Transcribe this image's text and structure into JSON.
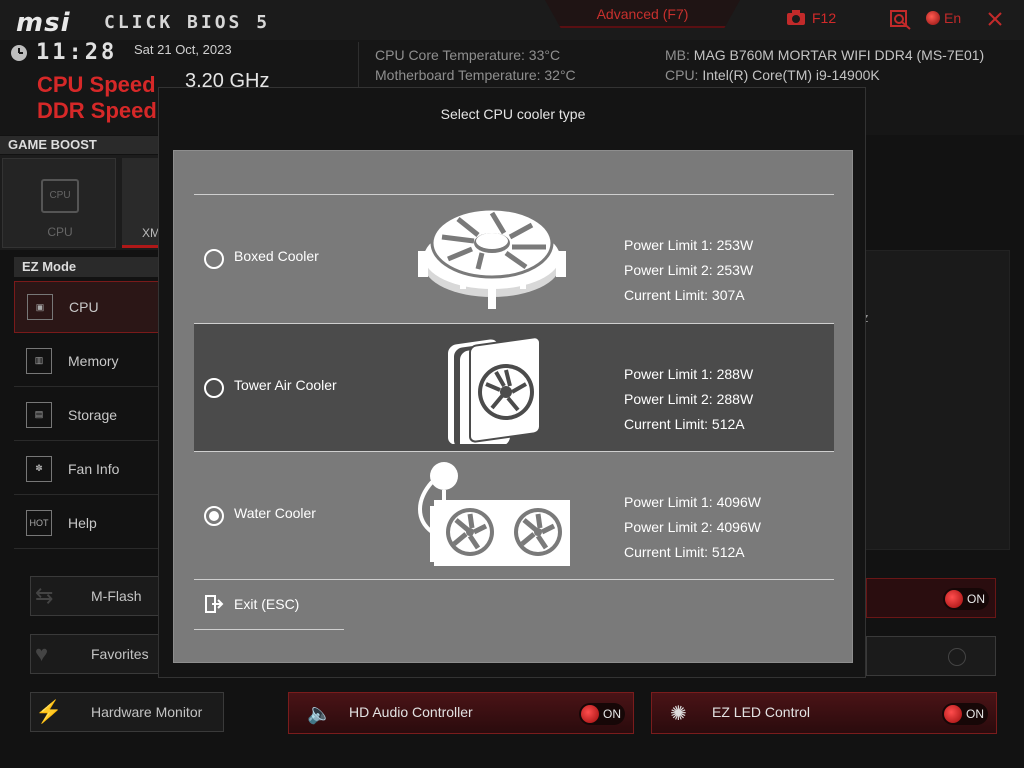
{
  "header": {
    "logo": "msi",
    "bios_name": "CLICK BIOS 5",
    "advanced_tab": "Advanced (F7)",
    "screenshot_key": "F12",
    "language": "En",
    "icons": [
      "camera-icon",
      "search-icon",
      "globe-icon",
      "close-icon"
    ]
  },
  "info": {
    "time": "11:28",
    "date": "Sat  21 Oct, 2023",
    "cpu_speed_label": "CPU Speed",
    "cpu_speed_value": "3.20 GHz",
    "ddr_speed_label": "DDR Speed",
    "cpu_temp": "CPU Core Temperature: 33°C",
    "mb_temp": "Motherboard Temperature: 32°C",
    "mb_label": "MB:",
    "mb_value": "MAG B760M MORTAR WIFI DDR4 (MS-7E01)",
    "cpu_label": "CPU:",
    "cpu_value": "Intel(R) Core(TM) i9-14900K"
  },
  "game_boost": {
    "title": "GAME BOOST",
    "cpu_tab": "CPU",
    "xmp_tab": "XM"
  },
  "ez_mode": {
    "title": "EZ Mode",
    "items": [
      {
        "label": "CPU",
        "icon": "cpu-icon"
      },
      {
        "label": "Memory",
        "icon": "memory-icon"
      },
      {
        "label": "Storage",
        "icon": "storage-icon"
      },
      {
        "label": "Fan Info",
        "icon": "fan-icon"
      },
      {
        "label": "Help",
        "icon": "hotkey-icon"
      }
    ]
  },
  "side_buttons": {
    "mflash": "M-Flash",
    "favorites": "Favorites",
    "hw_monitor": "Hardware Monitor"
  },
  "background": {
    "z_text": "z",
    "hd_audio": "HD Audio Controller",
    "ez_led": "EZ LED Control",
    "on_label": "ON"
  },
  "modal": {
    "title": "Select CPU cooler type",
    "options": [
      {
        "name": "Boxed Cooler",
        "selected": false,
        "highlighted": false,
        "pl1": "Power Limit 1: 253W",
        "pl2": "Power Limit 2: 253W",
        "current": "Current Limit: 307A"
      },
      {
        "name": "Tower Air Cooler",
        "selected": false,
        "highlighted": true,
        "pl1": "Power Limit 1: 288W",
        "pl2": "Power Limit 2: 288W",
        "current": "Current Limit: 512A"
      },
      {
        "name": "Water Cooler",
        "selected": true,
        "highlighted": false,
        "pl1": "Power Limit 1: 4096W",
        "pl2": "Power Limit 2: 4096W",
        "current": "Current Limit: 512A"
      }
    ],
    "exit_label": "Exit (ESC)"
  },
  "colors": {
    "accent_red": "#d62828",
    "modal_panel": "#7a7a7a",
    "selected_row": "#4b4b4b"
  }
}
